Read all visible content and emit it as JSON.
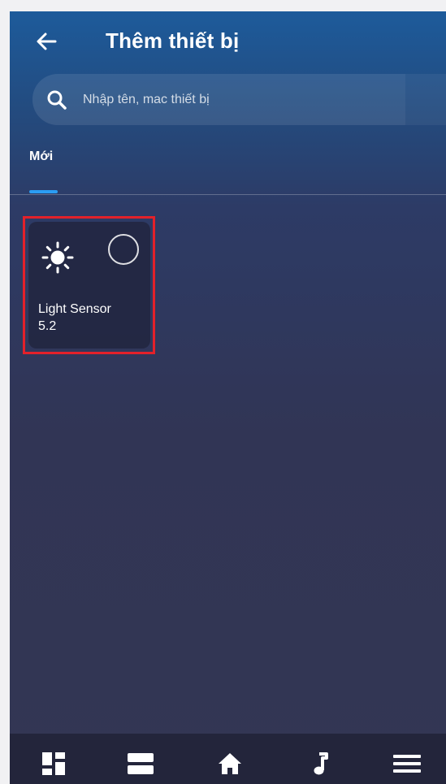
{
  "header": {
    "title": "Thêm thiết bị",
    "back_icon": "arrow-left-icon"
  },
  "search": {
    "placeholder": "Nhập tên, mac thiết bị",
    "value": "",
    "icon": "search-icon"
  },
  "tabs": [
    {
      "label": "Mới",
      "active": true
    }
  ],
  "devices": [
    {
      "name": "Light Sensor",
      "version": "5.2",
      "icon": "sun-icon",
      "selected": false,
      "highlighted": true
    }
  ],
  "bottom_nav": [
    {
      "icon": "dashboard-icon"
    },
    {
      "icon": "stack-icon"
    },
    {
      "icon": "home-icon"
    },
    {
      "icon": "music-note-icon"
    },
    {
      "icon": "menu-icon"
    }
  ],
  "colors": {
    "tab_indicator": "#2b9df3",
    "highlight_border": "#e3212a",
    "nav_bg": "#23253b"
  }
}
